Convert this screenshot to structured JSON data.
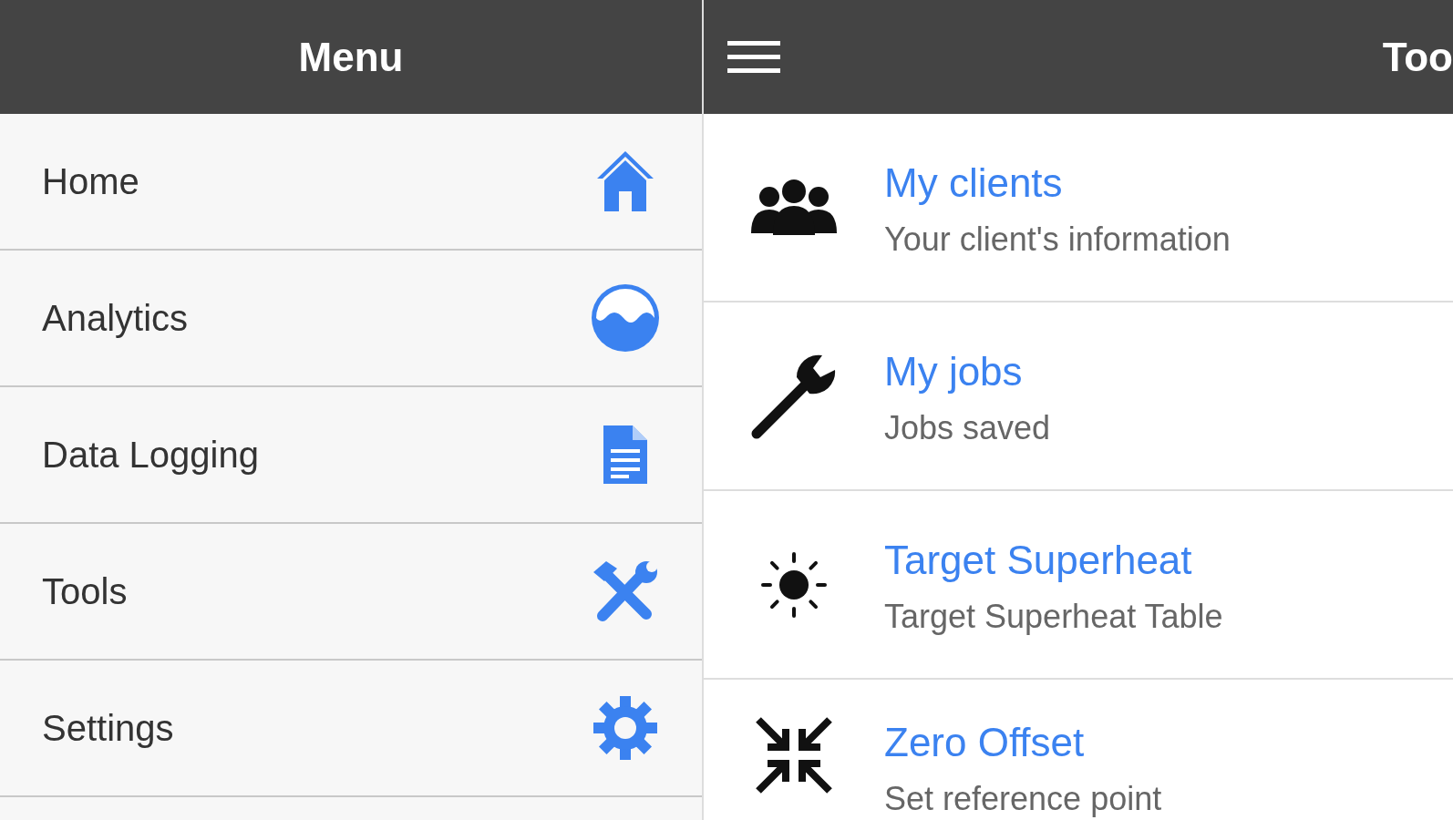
{
  "menu": {
    "title": "Menu",
    "items": [
      {
        "label": "Home"
      },
      {
        "label": "Analytics"
      },
      {
        "label": "Data Logging"
      },
      {
        "label": "Tools"
      },
      {
        "label": "Settings"
      }
    ]
  },
  "main": {
    "title": "Too",
    "items": [
      {
        "title": "My clients",
        "subtitle": "Your client's information"
      },
      {
        "title": "My jobs",
        "subtitle": "Jobs saved"
      },
      {
        "title": "Target Superheat",
        "subtitle": "Target Superheat Table"
      },
      {
        "title": "Zero Offset",
        "subtitle": "Set reference point"
      }
    ]
  }
}
